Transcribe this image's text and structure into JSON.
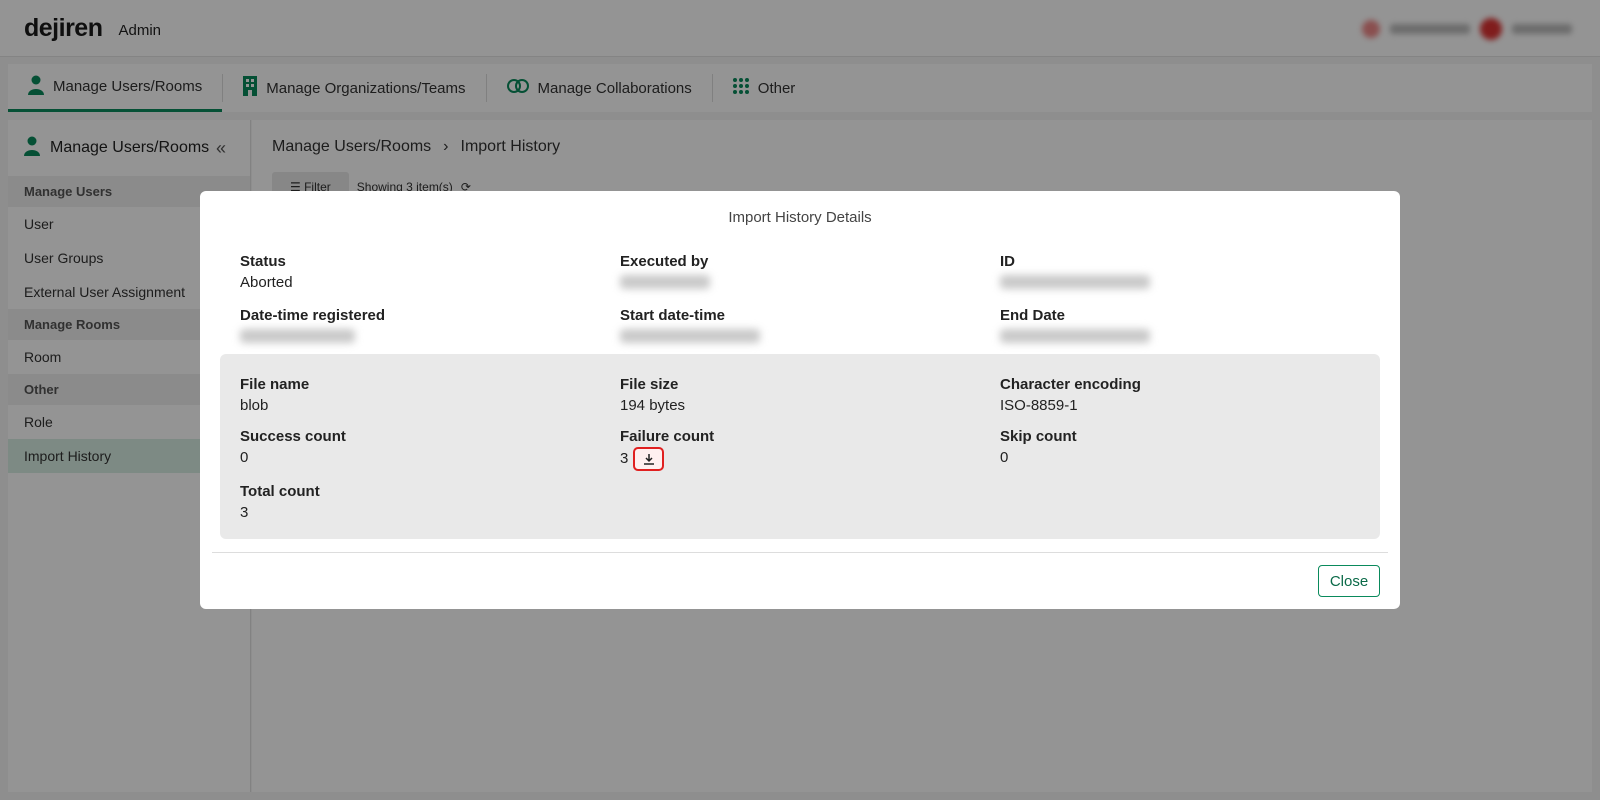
{
  "header": {
    "logo": "dejiren",
    "admin_label": "Admin"
  },
  "nav_tabs": [
    {
      "label": "Manage Users/Rooms",
      "icon": "person-icon",
      "active": true
    },
    {
      "label": "Manage Organizations/Teams",
      "icon": "building-icon",
      "active": false
    },
    {
      "label": "Manage Collaborations",
      "icon": "link-icon",
      "active": false
    },
    {
      "label": "Other",
      "icon": "grid-dots-icon",
      "active": false
    }
  ],
  "sidebar": {
    "title": "Manage Users/Rooms",
    "sections": [
      {
        "title": "Manage Users",
        "items": [
          "User",
          "User Groups",
          "External User Assignment"
        ]
      },
      {
        "title": "Manage Rooms",
        "items": [
          "Room"
        ]
      },
      {
        "title": "Other",
        "items": [
          "Role",
          "Import History"
        ]
      }
    ],
    "active_item": "Import History"
  },
  "breadcrumb": {
    "parent": "Manage Users/Rooms",
    "separator": "›",
    "current": "Import History"
  },
  "toolbar": {
    "filter_label": "Filter",
    "showing_label": "Showing 3 item(s)"
  },
  "modal": {
    "title": "Import History Details",
    "status_label": "Status",
    "status_value": "Aborted",
    "executed_by_label": "Executed by",
    "id_label": "ID",
    "registered_label": "Date-time registered",
    "start_label": "Start date-time",
    "end_label": "End Date",
    "file_name_label": "File name",
    "file_name_value": "blob",
    "file_size_label": "File size",
    "file_size_value": "194 bytes",
    "encoding_label": "Character encoding",
    "encoding_value": "ISO-8859-1",
    "success_label": "Success count",
    "success_value": "0",
    "failure_label": "Failure count",
    "failure_value": "3",
    "skip_label": "Skip count",
    "skip_value": "0",
    "total_label": "Total count",
    "total_value": "3",
    "close_label": "Close"
  },
  "colors": {
    "accent": "#0a8a5c",
    "highlight": "#e02020"
  }
}
